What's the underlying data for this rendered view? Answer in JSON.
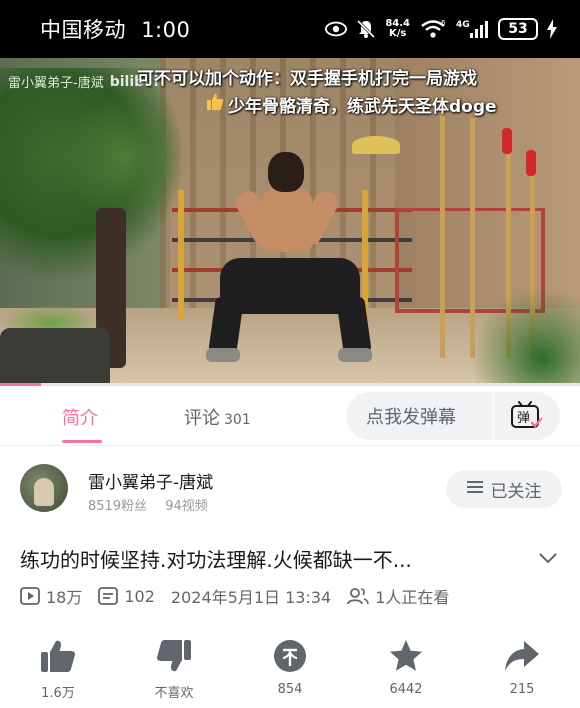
{
  "status_bar": {
    "carrier": "中国移动",
    "time": "1:00",
    "speed_value": "84.4",
    "speed_unit": "K/s",
    "network": "4G",
    "battery": "53",
    "wifi_badge": "6"
  },
  "video": {
    "watermark_user": "雷小翼弟子-唐斌",
    "watermark_logo": "bilibili",
    "danmaku": [
      {
        "text": "可不可以加个动作：双手握手机打完一局游戏"
      },
      {
        "text": "少年骨骼清奇，练武先天圣体doge",
        "icon": "thumbs-up-icon"
      }
    ],
    "progress": 0.07
  },
  "tabs": {
    "intro": "简介",
    "comments": "评论",
    "comments_count": "301"
  },
  "danmaku_input": {
    "placeholder": "点我发弹幕",
    "toggle_label": "弹"
  },
  "uploader": {
    "name": "雷小翼弟子-唐斌",
    "fans": "8519粉丝",
    "videos": "94视频",
    "follow_label": "已关注"
  },
  "video_info": {
    "title": "练功的时候坚持.对功法理解.火候都缺一不...",
    "views": "18万",
    "danmaku_count": "102",
    "publish_time": "2024年5月1日 13:34",
    "watching": "1人正在看"
  },
  "actions": [
    {
      "icon": "like-icon",
      "label": "1.6万"
    },
    {
      "icon": "dislike-icon",
      "label": "不喜欢"
    },
    {
      "icon": "coin-icon",
      "label": "854"
    },
    {
      "icon": "favorite-icon",
      "label": "6442"
    },
    {
      "icon": "share-icon",
      "label": "215"
    }
  ],
  "colors": {
    "accent": "#fb7299",
    "text_primary": "#18191c",
    "text_secondary": "#61666d",
    "icon_gray": "#61666d"
  }
}
